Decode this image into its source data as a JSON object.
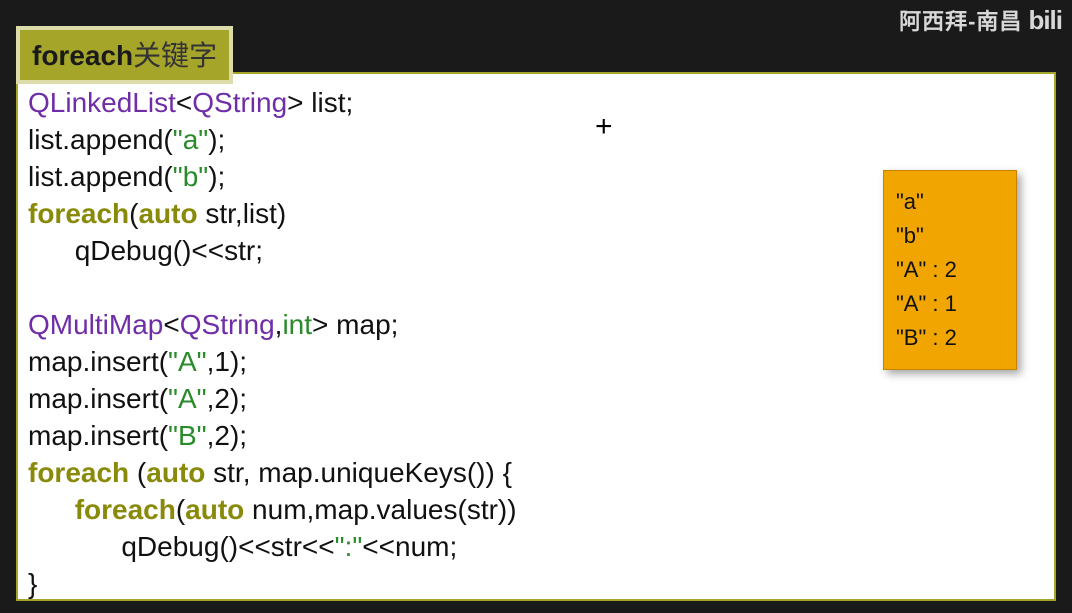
{
  "watermark": {
    "text": "阿西拜-南昌",
    "logo": "bili"
  },
  "title": {
    "keyword": "foreach",
    "suffix": "关键字"
  },
  "code": {
    "l1": {
      "t1": "QLinkedList",
      "a1": "<",
      "t2": "QString",
      "a2": ">",
      "rest": " list;"
    },
    "l2": {
      "pre": "list.append(",
      "str": "\"a\"",
      "post": ");"
    },
    "l3": {
      "pre": "list.append(",
      "str": "\"b\"",
      "post": ");"
    },
    "l4": {
      "kw": "foreach",
      "p1": "(",
      "auto": "auto",
      "mid": " str,list)"
    },
    "l5": {
      "indent": "      ",
      "qd": "qDebug",
      "rest": "()<<str;"
    },
    "blank": "",
    "l6": {
      "t1": "QMultiMap",
      "a1": "<",
      "t2": "QString",
      "comma": ",",
      "t3": "int",
      "a2": ">",
      "rest": " map;"
    },
    "l7": {
      "pre": "map.insert(",
      "str": "\"A\"",
      "mid": ",1);"
    },
    "l8": {
      "pre": "map.insert(",
      "str": "\"A\"",
      "mid": ",2);"
    },
    "l9": {
      "pre": "map.insert(",
      "str": "\"B\"",
      "mid": ",2);"
    },
    "l10": {
      "kw": "foreach",
      "p1": " (",
      "auto": "auto",
      "mid": " str, map.uniqueKeys()) {"
    },
    "l11": {
      "indent": "      ",
      "kw": "foreach",
      "p1": "(",
      "auto": "auto",
      "mid": " num,map.values(str))"
    },
    "l12": {
      "indent": "            ",
      "qd": "qDebug",
      "r1": "()<<str<<",
      "str": "\":\"",
      "r2": "<<num;"
    },
    "l13": {
      "text": "}"
    }
  },
  "output": {
    "lines": [
      "\"a\"",
      "\"b\"",
      "\"A\" : 2",
      "\"A\" : 1",
      "\"B\" : 2"
    ]
  }
}
